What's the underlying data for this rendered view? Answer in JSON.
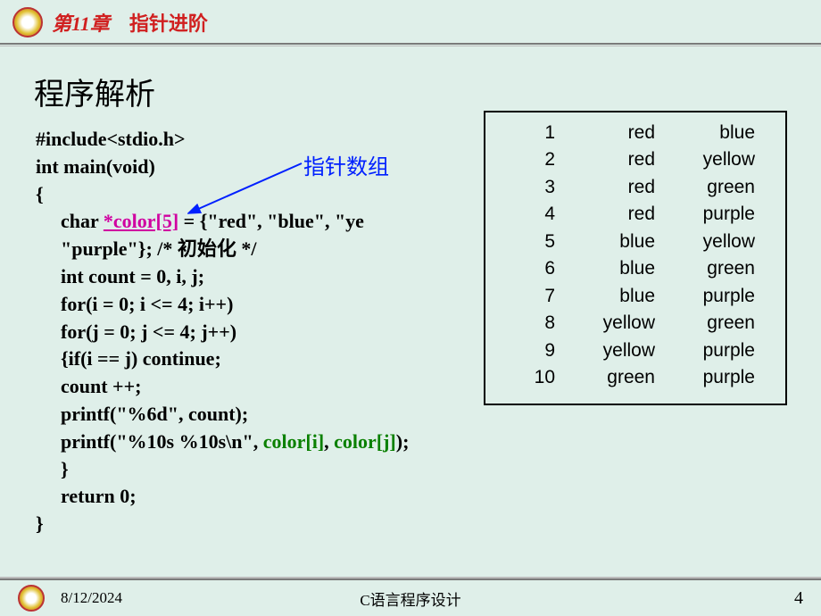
{
  "chapter": {
    "prefix": "第",
    "num": "11",
    "suffix": "章",
    "name": "指针进阶"
  },
  "heading": "程序解析",
  "annotation": "指针数组",
  "code": {
    "l1": "#include<stdio.h>",
    "l2": "int main(void)",
    "l3": "{",
    "l4_pre": "char ",
    "l4_red": "*color[5]",
    "l4_post": " = {\"red\", \"blue\", \"ye",
    "l5": " \"purple\"};  /* 初始化 */",
    "l6": "int count = 0, i, j;",
    "l7": "for(i = 0; i <= 4; i++)",
    "l8": " for(j = 0; j <= 4; j++)",
    "l9": "  {if(i == j)  continue;",
    "l10": "    count ++;",
    "l11": "    printf(\"%6d\", count);",
    "l12_pre": "    printf(\"%10s %10s\\n\", ",
    "l12_g1": "color[i]",
    "l12_mid": ", ",
    "l12_g2": "color[j]",
    "l12_post": ");",
    "l13": "}",
    "l14": " return 0;",
    "l15": "}"
  },
  "output": [
    {
      "n": "1",
      "a": "red",
      "b": "blue"
    },
    {
      "n": "2",
      "a": "red",
      "b": "yellow"
    },
    {
      "n": "3",
      "a": "red",
      "b": "green"
    },
    {
      "n": "4",
      "a": "red",
      "b": "purple"
    },
    {
      "n": "5",
      "a": "blue",
      "b": "yellow"
    },
    {
      "n": "6",
      "a": "blue",
      "b": "green"
    },
    {
      "n": "7",
      "a": "blue",
      "b": "purple"
    },
    {
      "n": "8",
      "a": "yellow",
      "b": "green"
    },
    {
      "n": "9",
      "a": "yellow",
      "b": "purple"
    },
    {
      "n": "10",
      "a": "green",
      "b": "purple"
    }
  ],
  "footer": {
    "date": "8/12/2024",
    "course": "C语言程序设计",
    "page": "4"
  }
}
